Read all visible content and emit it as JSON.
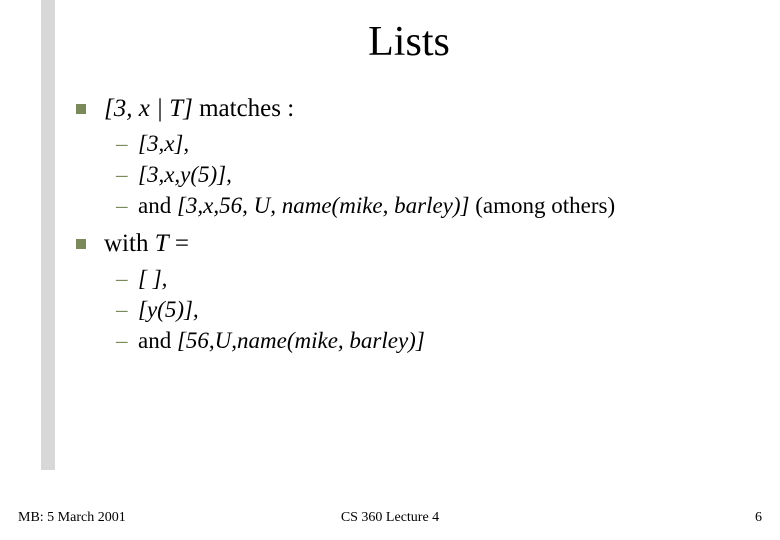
{
  "title": "Lists",
  "main1": {
    "pattern": "[3, x | T]",
    "afterPattern": " matches :"
  },
  "sub1": {
    "text": "[3,x],"
  },
  "sub2": {
    "text": "[3,x,y(5)],"
  },
  "sub3": {
    "prefix": "and ",
    "expr": "[3,x,56, U, name(mike, barley)]",
    "suffix": " (among others)"
  },
  "main2": {
    "prefix": "with ",
    "var": "T",
    "suffix": " ="
  },
  "sub4": {
    "text": "[ ],"
  },
  "sub5": {
    "text": "[y(5)],"
  },
  "sub6": {
    "prefix": "and ",
    "expr": "[56,U,name(mike, barley)]"
  },
  "footer": {
    "left": "MB: 5 March 2001",
    "center": "CS 360  Lecture 4",
    "right": "6"
  }
}
